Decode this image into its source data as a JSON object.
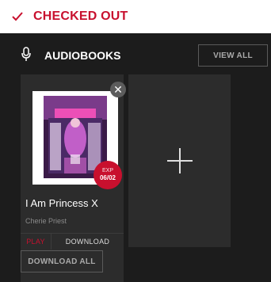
{
  "header": {
    "title": "CHECKED OUT",
    "icon": "check-icon",
    "accent": "#c8102e"
  },
  "section": {
    "icon": "microphone-icon",
    "title": "AUDIOBOOKS",
    "view_all_label": "VIEW ALL"
  },
  "book": {
    "title": "I Am Princess X",
    "author": "Cherie Priest",
    "exp_label": "EXP",
    "exp_date": "06/02",
    "close_icon": "close-icon",
    "play_label": "PLAY",
    "download_label": "DOWNLOAD"
  },
  "add_card": {
    "icon": "plus-icon"
  },
  "download_all_label": "DOWNLOAD ALL"
}
